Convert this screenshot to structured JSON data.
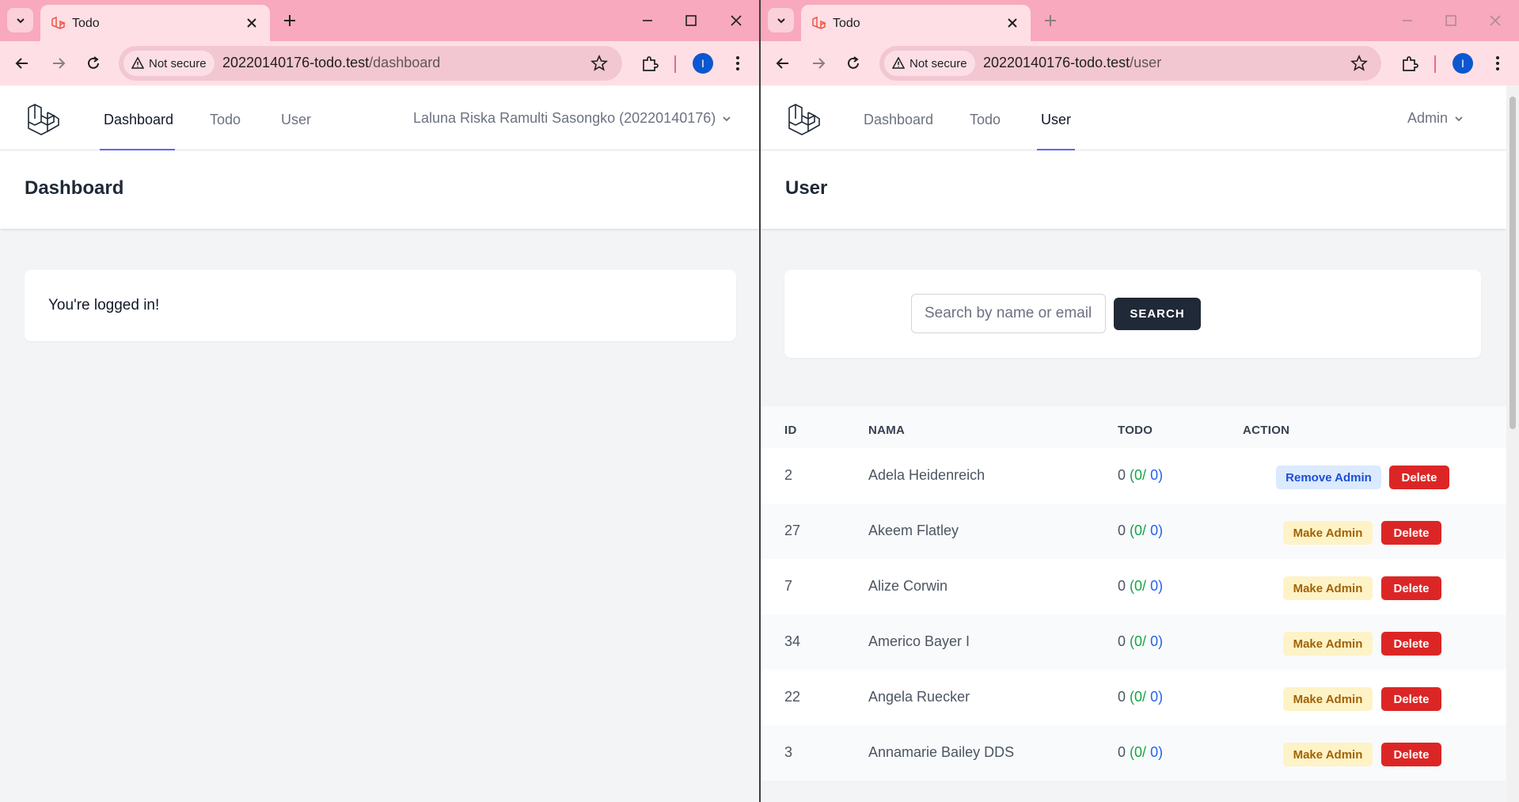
{
  "left_window": {
    "tab_title": "Todo",
    "security_label": "Not secure",
    "url_host": "20220140176-todo.test",
    "url_path": "/dashboard",
    "profile_initial": "I",
    "nav": {
      "links": [
        "Dashboard",
        "Todo",
        "User"
      ],
      "active": "Dashboard",
      "user_menu": "Laluna Riska Ramulti Sasongko (20220140176)"
    },
    "page_title": "Dashboard",
    "message": "You're logged in!"
  },
  "right_window": {
    "tab_title": "Todo",
    "security_label": "Not secure",
    "url_host": "20220140176-todo.test",
    "url_path": "/user",
    "profile_initial": "I",
    "nav": {
      "links": [
        "Dashboard",
        "Todo",
        "User"
      ],
      "active": "User",
      "user_menu": "Admin"
    },
    "page_title": "User",
    "search": {
      "placeholder": "Search by name or email",
      "button_label": "SEARCH"
    },
    "table": {
      "headers": [
        "ID",
        "NAMA",
        "TODO",
        "ACTION"
      ],
      "rows": [
        {
          "id": "2",
          "name": "Adela Heidenreich",
          "todo_total": "0",
          "todo_done": "0",
          "todo_pending": "0",
          "admin_action": "Remove Admin",
          "delete_label": "Delete"
        },
        {
          "id": "27",
          "name": "Akeem Flatley",
          "todo_total": "0",
          "todo_done": "0",
          "todo_pending": "0",
          "admin_action": "Make Admin",
          "delete_label": "Delete"
        },
        {
          "id": "7",
          "name": "Alize Corwin",
          "todo_total": "0",
          "todo_done": "0",
          "todo_pending": "0",
          "admin_action": "Make Admin",
          "delete_label": "Delete"
        },
        {
          "id": "34",
          "name": "Americo Bayer I",
          "todo_total": "0",
          "todo_done": "0",
          "todo_pending": "0",
          "admin_action": "Make Admin",
          "delete_label": "Delete"
        },
        {
          "id": "22",
          "name": "Angela Ruecker",
          "todo_total": "0",
          "todo_done": "0",
          "todo_pending": "0",
          "admin_action": "Make Admin",
          "delete_label": "Delete"
        },
        {
          "id": "3",
          "name": "Annamarie Bailey DDS",
          "todo_total": "0",
          "todo_done": "0",
          "todo_pending": "0",
          "admin_action": "Make Admin",
          "delete_label": "Delete"
        }
      ]
    }
  },
  "colors": {
    "tabstrip": "#f8a9bd",
    "toolbar": "#ffdfe6",
    "accent_underline": "#6366f1",
    "delete_red": "#dc2626",
    "search_button": "#1f2937"
  }
}
